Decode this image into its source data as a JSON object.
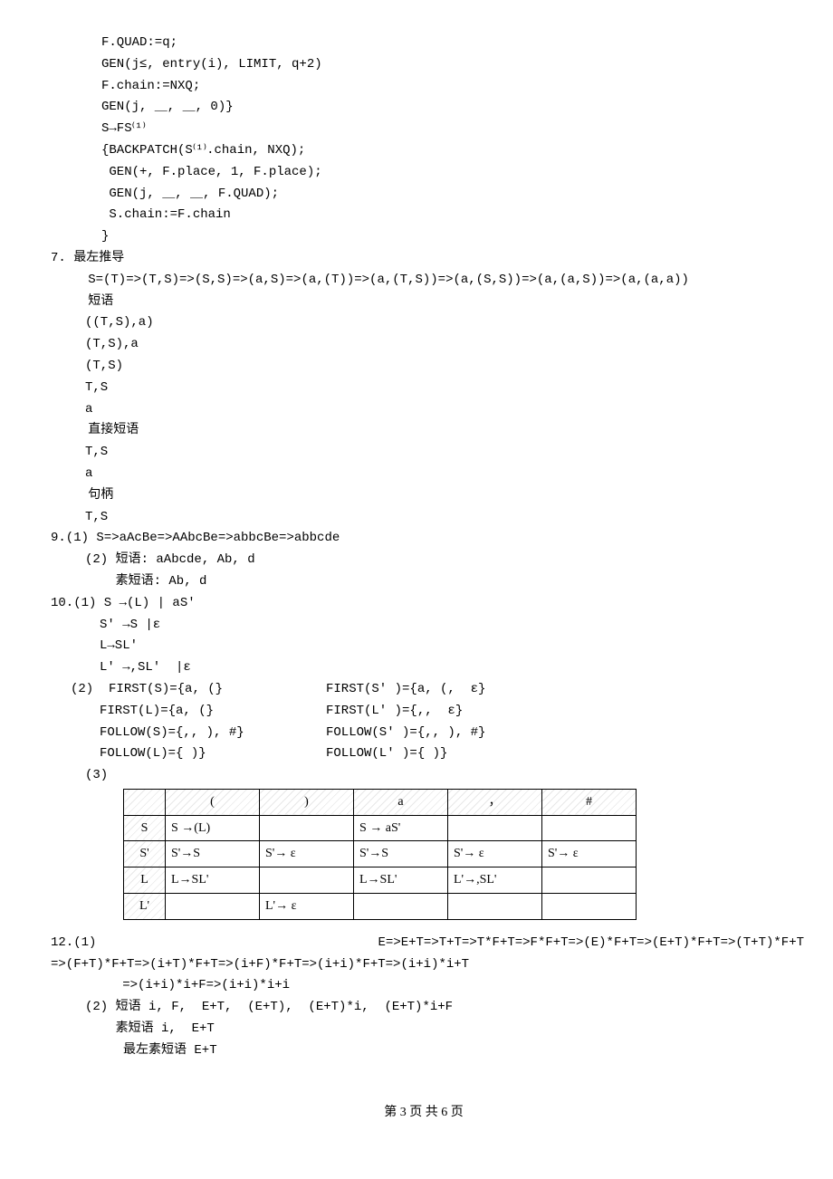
{
  "code_block": [
    "F.QUAD:=q;",
    "GEN(j≤, entry(i), LIMIT, q+2)",
    "F.chain:=NXQ;",
    "GEN(j, ＿, ＿, 0)}",
    "S→FS⁽¹⁾",
    "{BACKPATCH(S⁽¹⁾.chain, NXQ);",
    " GEN(+, F.place, 1, F.place);",
    " GEN(j, ＿, ＿, F.QUAD);",
    " S.chain:=F.chain",
    "}"
  ],
  "q7": {
    "title": "7. 最左推导",
    "deriv": "   S=(T)=>(T,S)=>(S,S)=>(a,S)=>(a,(T))=>(a,(T,S))=>(a,(S,S))=>(a,(a,S))=>(a,(a,a))",
    "phrase_label": "   短语",
    "phrases": [
      "((T,S),a)",
      "(T,S),a",
      "(T,S)",
      "T,S",
      "a"
    ],
    "direct_label": "   直接短语",
    "direct": [
      "T,S",
      "a"
    ],
    "handle_label": "   句柄",
    "handle": [
      "T,S"
    ]
  },
  "q9": {
    "l1": "9.(1) S=>aAcBe=>AAbcBe=>abbcBe=>abbcde",
    "l2": "(2) 短语: aAbcde, Ab, d",
    "l3": "    素短语: Ab, d"
  },
  "q10": {
    "part1_head": "10.(1) S →(L) | aS'",
    "part1": [
      "S' →S |ε",
      "L→SL'",
      "L' →,SL'  |ε"
    ],
    "part2_head": "(2)",
    "first_follow_left": [
      "FIRST(S)={a, (}",
      "FIRST(L)={a, (}",
      "FOLLOW(S)={,, ), #}",
      "FOLLOW(L)={ )}"
    ],
    "first_follow_right": [
      "FIRST(S' )={a, (,  ε}",
      "FIRST(L' )={,,  ε}",
      "FOLLOW(S' )={,, ), #}",
      "FOLLOW(L' )={ )}"
    ],
    "part3_head": "(3)"
  },
  "table": {
    "headers": [
      "",
      "(",
      ")",
      "a",
      "，",
      "#"
    ],
    "rows": [
      [
        "S",
        "S →(L)",
        "",
        "S → aS'",
        "",
        ""
      ],
      [
        "S'",
        "S'→S",
        "S'→ ε",
        "S'→S",
        "S'→ ε",
        "S'→ ε"
      ],
      [
        "L",
        "L→SL'",
        "",
        "L→SL'",
        "L'→,SL'",
        ""
      ],
      [
        "L'",
        "",
        "L'→ ε",
        "",
        "",
        ""
      ]
    ]
  },
  "q12": {
    "l1_left": "12.(1)",
    "l1_right": "E=>E+T=>T+T=>T*F+T=>F*F+T=>(E)*F+T=>(E+T)*F+T=>(T+T)*F+T",
    "l2": "=>(F+T)*F+T=>(i+T)*F+T=>(i+F)*F+T=>(i+i)*F+T=>(i+i)*i+T",
    "l3": "   =>(i+i)*i+F=>(i+i)*i+i",
    "l4": "(2) 短语 i, F,  E+T,  (E+T),  (E+T)*i,  (E+T)*i+F",
    "l5": "    素短语 i,  E+T",
    "l6": "     最左素短语 E+T"
  },
  "footer": "第 3 页 共 6 页"
}
